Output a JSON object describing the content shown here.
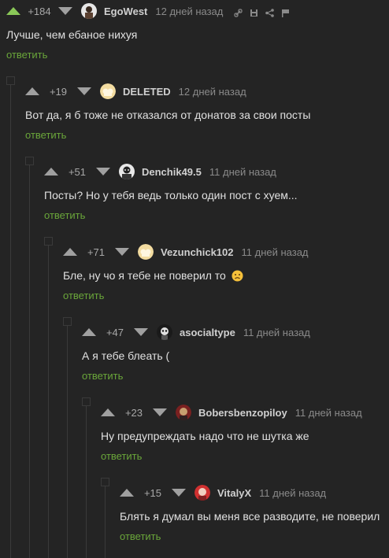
{
  "comments": [
    {
      "rating": "+184",
      "user": "EgoWest",
      "time": "12 дней назад",
      "text": "Лучше, чем ебаное нихуя",
      "reply": "ответить"
    },
    {
      "rating": "+19",
      "user": "DELETED",
      "time": "12 дней назад",
      "text": "Вот да, я б тоже не отказался от донатов за свои посты",
      "reply": "ответить"
    },
    {
      "rating": "+51",
      "user": "Denchik49.5",
      "time": "11 дней назад",
      "text": "Посты? Но у тебя ведь только один пост с хуем...",
      "reply": "ответить"
    },
    {
      "rating": "+71",
      "user": "Vezunchick102",
      "time": "11 дней назад",
      "text": "Бле, ну чо я тебе не поверил то",
      "reply": "ответить"
    },
    {
      "rating": "+47",
      "user": "asocialtype",
      "time": "11 дней назад",
      "text": "А я тебе блеать (",
      "reply": "ответить"
    },
    {
      "rating": "+23",
      "user": "Bobersbenzopiloy",
      "time": "11 дней назад",
      "text": "Ну предупреждать надо что не шутка же",
      "reply": "ответить"
    },
    {
      "rating": "+15",
      "user": "VitalyX",
      "time": "11 дней назад",
      "text": "Блять я думал вы меня все разводите, не поверил",
      "reply": "ответить"
    }
  ],
  "icons": {
    "upvote": "triangle-up",
    "downvote": "triangle-down",
    "link": "link-icon",
    "save": "save-icon",
    "share": "share-icon",
    "report": "flag-icon",
    "emoji": "sad-face-emoji"
  },
  "colors": {
    "background": "#242424",
    "reply": "#6aa63a",
    "upvoted": "#8ac858"
  }
}
